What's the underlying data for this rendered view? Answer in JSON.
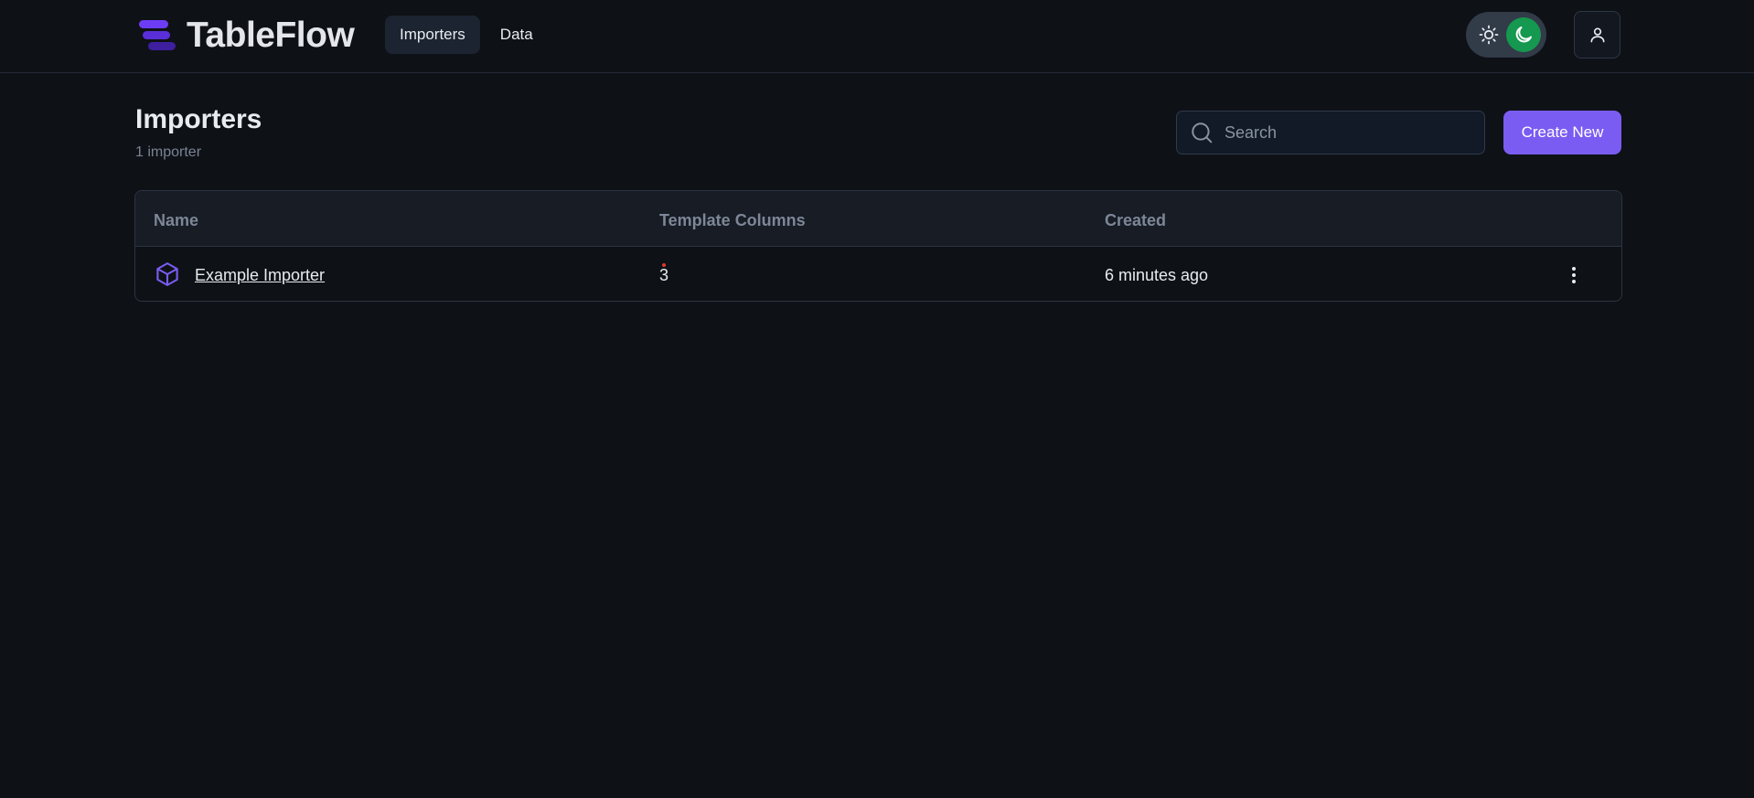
{
  "header": {
    "brand": "TableFlow",
    "nav": [
      {
        "label": "Importers",
        "active": true
      },
      {
        "label": "Data",
        "active": false
      }
    ],
    "theme_toggle": {
      "mode": "dark",
      "light_icon": "sun-icon",
      "dark_icon": "moon-icon",
      "accent": "#15984f"
    },
    "user_icon": "user-icon"
  },
  "page": {
    "title": "Importers",
    "subtitle": "1 importer",
    "search": {
      "placeholder": "Search",
      "value": ""
    },
    "create_label": "Create New"
  },
  "table": {
    "columns": [
      "Name",
      "Template Columns",
      "Created"
    ],
    "rows": [
      {
        "name": "Example Importer",
        "icon": "cube-icon",
        "template_columns": "3",
        "created": "6 minutes ago"
      }
    ]
  },
  "colors": {
    "background": "#0e1116",
    "accent": "#7a5cf2",
    "toggle_active": "#15984f"
  }
}
